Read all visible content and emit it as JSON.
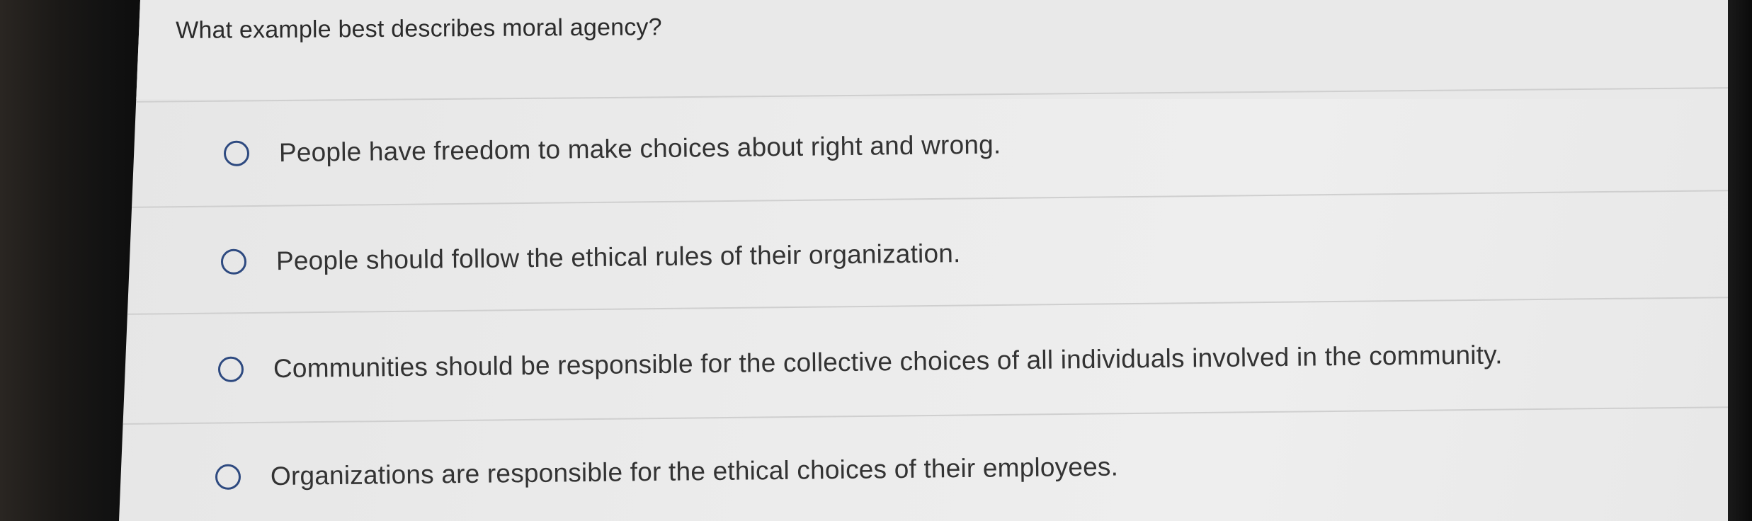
{
  "question": {
    "text": "What example best describes moral agency?"
  },
  "options": [
    {
      "label": "People have freedom to make choices about right and wrong.",
      "selected": false
    },
    {
      "label": "People should follow the ethical rules of their organization.",
      "selected": false
    },
    {
      "label": "Communities should be responsible for the collective choices of all individuals involved in the community.",
      "selected": false
    },
    {
      "label": "Organizations are responsible for the ethical choices of their employees.",
      "selected": false
    }
  ],
  "colors": {
    "radio_border": "#2e4a80",
    "text": "#333333",
    "background": "#ebebeb"
  }
}
